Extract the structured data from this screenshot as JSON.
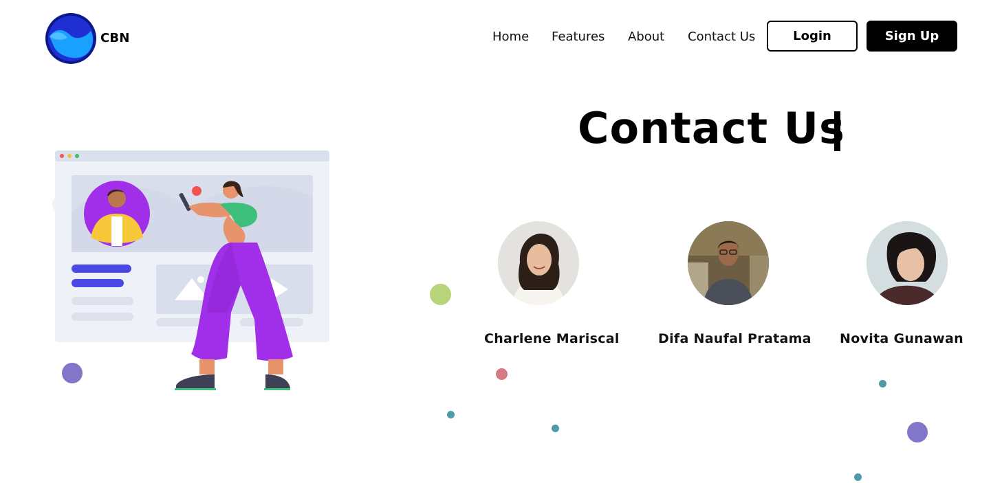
{
  "brand": {
    "name": "CBN"
  },
  "nav": {
    "home": "Home",
    "features": "Features",
    "about": "About",
    "contact": "Contact Us"
  },
  "auth": {
    "login": "Login",
    "signup": "Sign Up"
  },
  "hero": {
    "title": "Contact Us"
  },
  "team": [
    {
      "name": "Charlene Mariscal"
    },
    {
      "name": "Difa Naufal Pratama"
    },
    {
      "name": "Novita Gunawan"
    }
  ],
  "colors": {
    "logo_primary": "#1a2fd6",
    "logo_dark": "#0b1a8a",
    "purple": "#a12ee8",
    "dot_purple": "#8176c7",
    "dot_green": "#b8d47a",
    "dot_red": "#d47a80",
    "dot_teal": "#4e9aa6"
  }
}
